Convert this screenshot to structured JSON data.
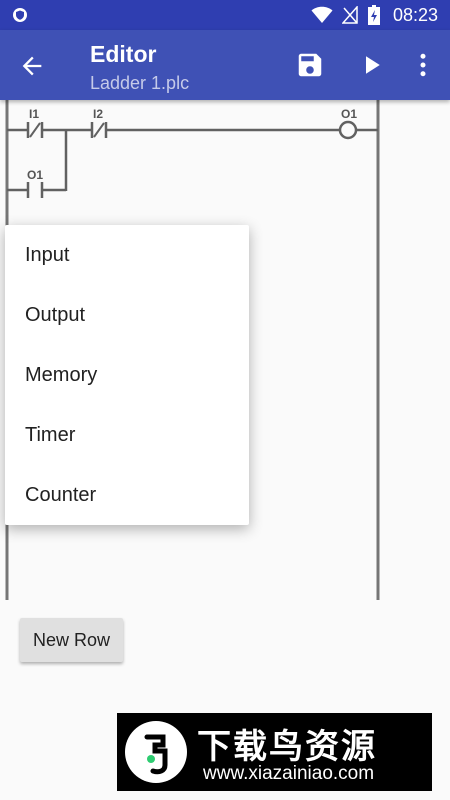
{
  "status_bar": {
    "time": "08:23"
  },
  "toolbar": {
    "title": "Editor",
    "subtitle": "Ladder 1.plc"
  },
  "ladder": {
    "contacts": [
      {
        "label": "I1",
        "type": "normally-closed"
      },
      {
        "label": "I2",
        "type": "normally-closed"
      },
      {
        "label": "O1",
        "type": "normally-open"
      }
    ],
    "coil": {
      "label": "O1"
    }
  },
  "menu": {
    "items": [
      "Input",
      "Output",
      "Memory",
      "Timer",
      "Counter"
    ]
  },
  "new_row_label": "New Row",
  "watermark": {
    "title": "下载鸟资源",
    "url": "www.xiazainiao.com"
  },
  "colors": {
    "primary": "#3f51b5",
    "status_bar": "#2f3eb1",
    "rail": "#757575"
  }
}
